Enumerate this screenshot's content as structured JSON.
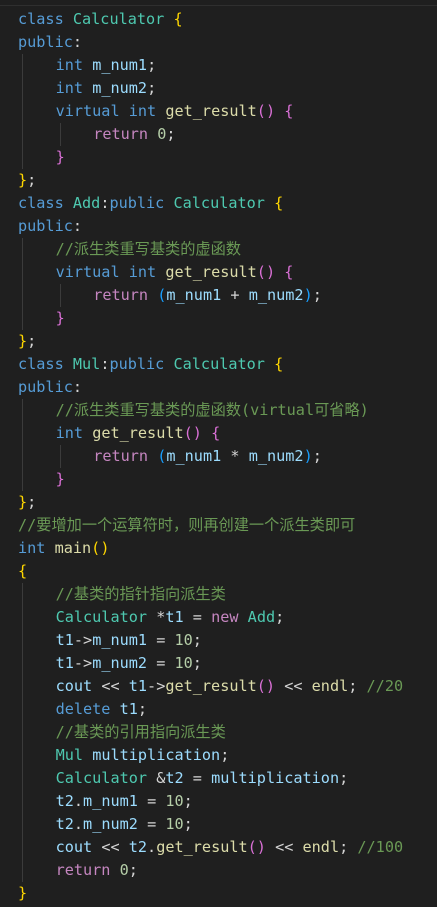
{
  "editor": {
    "language": "cpp",
    "colors": {
      "background": "#1f1f1f",
      "keyword": "#569cd6",
      "control": "#c586c0",
      "type": "#4ec9b0",
      "function": "#dcdcaa",
      "variable": "#9cdcfe",
      "number": "#b5cea8",
      "comment": "#6a9955",
      "text": "#d4d4d4",
      "bracket_1": "#ffd700",
      "bracket_2": "#da70d6",
      "bracket_3": "#179fff"
    },
    "lines": [
      {
        "indent": 0,
        "tokens": [
          {
            "k": "kw",
            "t": "class"
          },
          {
            "k": "pu",
            "t": " "
          },
          {
            "k": "ty",
            "t": "Calculator"
          },
          {
            "k": "pu",
            "t": " "
          },
          {
            "k": "b1",
            "t": "{"
          }
        ]
      },
      {
        "indent": 0,
        "tokens": [
          {
            "k": "kw",
            "t": "public"
          },
          {
            "k": "pu",
            "t": ":"
          }
        ]
      },
      {
        "indent": 1,
        "tokens": [
          {
            "k": "kw",
            "t": "int"
          },
          {
            "k": "pu",
            "t": " "
          },
          {
            "k": "var",
            "t": "m_num1"
          },
          {
            "k": "pu",
            "t": ";"
          }
        ]
      },
      {
        "indent": 1,
        "tokens": [
          {
            "k": "kw",
            "t": "int"
          },
          {
            "k": "pu",
            "t": " "
          },
          {
            "k": "var",
            "t": "m_num2"
          },
          {
            "k": "pu",
            "t": ";"
          }
        ]
      },
      {
        "indent": 1,
        "tokens": [
          {
            "k": "kw",
            "t": "virtual"
          },
          {
            "k": "pu",
            "t": " "
          },
          {
            "k": "kw",
            "t": "int"
          },
          {
            "k": "pu",
            "t": " "
          },
          {
            "k": "fn",
            "t": "get_result"
          },
          {
            "k": "b2",
            "t": "()"
          },
          {
            "k": "pu",
            "t": " "
          },
          {
            "k": "b2",
            "t": "{"
          }
        ]
      },
      {
        "indent": 2,
        "tokens": [
          {
            "k": "ctl",
            "t": "return"
          },
          {
            "k": "pu",
            "t": " "
          },
          {
            "k": "num",
            "t": "0"
          },
          {
            "k": "pu",
            "t": ";"
          }
        ]
      },
      {
        "indent": 1,
        "tokens": [
          {
            "k": "b2",
            "t": "}"
          }
        ]
      },
      {
        "indent": 0,
        "tokens": [
          {
            "k": "b1",
            "t": "}"
          },
          {
            "k": "pu",
            "t": ";"
          }
        ]
      },
      {
        "indent": 0,
        "tokens": [
          {
            "k": "kw",
            "t": "class"
          },
          {
            "k": "pu",
            "t": " "
          },
          {
            "k": "ty",
            "t": "Add"
          },
          {
            "k": "pu",
            "t": ":"
          },
          {
            "k": "kw",
            "t": "public"
          },
          {
            "k": "pu",
            "t": " "
          },
          {
            "k": "ty",
            "t": "Calculator"
          },
          {
            "k": "pu",
            "t": " "
          },
          {
            "k": "b1",
            "t": "{"
          }
        ]
      },
      {
        "indent": 0,
        "tokens": [
          {
            "k": "kw",
            "t": "public"
          },
          {
            "k": "pu",
            "t": ":"
          }
        ]
      },
      {
        "indent": 1,
        "tokens": [
          {
            "k": "cm",
            "t": "//派生类重写基类的虚函数"
          }
        ]
      },
      {
        "indent": 1,
        "tokens": [
          {
            "k": "kw",
            "t": "virtual"
          },
          {
            "k": "pu",
            "t": " "
          },
          {
            "k": "kw",
            "t": "int"
          },
          {
            "k": "pu",
            "t": " "
          },
          {
            "k": "fn",
            "t": "get_result"
          },
          {
            "k": "b2",
            "t": "()"
          },
          {
            "k": "pu",
            "t": " "
          },
          {
            "k": "b2",
            "t": "{"
          }
        ]
      },
      {
        "indent": 2,
        "tokens": [
          {
            "k": "ctl",
            "t": "return"
          },
          {
            "k": "pu",
            "t": " "
          },
          {
            "k": "b3",
            "t": "("
          },
          {
            "k": "var",
            "t": "m_num1"
          },
          {
            "k": "op",
            "t": " + "
          },
          {
            "k": "var",
            "t": "m_num2"
          },
          {
            "k": "b3",
            "t": ")"
          },
          {
            "k": "pu",
            "t": ";"
          }
        ]
      },
      {
        "indent": 1,
        "tokens": [
          {
            "k": "b2",
            "t": "}"
          }
        ]
      },
      {
        "indent": 0,
        "tokens": [
          {
            "k": "b1",
            "t": "}"
          },
          {
            "k": "pu",
            "t": ";"
          }
        ]
      },
      {
        "indent": 0,
        "tokens": [
          {
            "k": "kw",
            "t": "class"
          },
          {
            "k": "pu",
            "t": " "
          },
          {
            "k": "ty",
            "t": "Mul"
          },
          {
            "k": "pu",
            "t": ":"
          },
          {
            "k": "kw",
            "t": "public"
          },
          {
            "k": "pu",
            "t": " "
          },
          {
            "k": "ty",
            "t": "Calculator"
          },
          {
            "k": "pu",
            "t": " "
          },
          {
            "k": "b1",
            "t": "{"
          }
        ]
      },
      {
        "indent": 0,
        "tokens": [
          {
            "k": "kw",
            "t": "public"
          },
          {
            "k": "pu",
            "t": ":"
          }
        ]
      },
      {
        "indent": 1,
        "tokens": [
          {
            "k": "cm",
            "t": "//派生类重写基类的虚函数(virtual可省略)"
          }
        ]
      },
      {
        "indent": 1,
        "tokens": [
          {
            "k": "kw",
            "t": "int"
          },
          {
            "k": "pu",
            "t": " "
          },
          {
            "k": "fn",
            "t": "get_result"
          },
          {
            "k": "b2",
            "t": "()"
          },
          {
            "k": "pu",
            "t": " "
          },
          {
            "k": "b2",
            "t": "{"
          }
        ]
      },
      {
        "indent": 2,
        "tokens": [
          {
            "k": "ctl",
            "t": "return"
          },
          {
            "k": "pu",
            "t": " "
          },
          {
            "k": "b3",
            "t": "("
          },
          {
            "k": "var",
            "t": "m_num1"
          },
          {
            "k": "op",
            "t": " * "
          },
          {
            "k": "var",
            "t": "m_num2"
          },
          {
            "k": "b3",
            "t": ")"
          },
          {
            "k": "pu",
            "t": ";"
          }
        ]
      },
      {
        "indent": 1,
        "tokens": [
          {
            "k": "b2",
            "t": "}"
          }
        ]
      },
      {
        "indent": 0,
        "tokens": [
          {
            "k": "b1",
            "t": "}"
          },
          {
            "k": "pu",
            "t": ";"
          }
        ]
      },
      {
        "indent": 0,
        "tokens": [
          {
            "k": "cm",
            "t": "//要增加一个运算符时，则再创建一个派生类即可"
          }
        ]
      },
      {
        "indent": 0,
        "tokens": [
          {
            "k": "kw",
            "t": "int"
          },
          {
            "k": "pu",
            "t": " "
          },
          {
            "k": "fn",
            "t": "main"
          },
          {
            "k": "b1",
            "t": "()"
          }
        ]
      },
      {
        "indent": 0,
        "tokens": [
          {
            "k": "b1",
            "t": "{"
          }
        ]
      },
      {
        "indent": 1,
        "tokens": [
          {
            "k": "cm",
            "t": "//基类的指针指向派生类"
          }
        ]
      },
      {
        "indent": 1,
        "tokens": [
          {
            "k": "ty",
            "t": "Calculator"
          },
          {
            "k": "pu",
            "t": " "
          },
          {
            "k": "op",
            "t": "*"
          },
          {
            "k": "var",
            "t": "t1"
          },
          {
            "k": "op",
            "t": " = "
          },
          {
            "k": "ctl",
            "t": "new"
          },
          {
            "k": "pu",
            "t": " "
          },
          {
            "k": "ty",
            "t": "Add"
          },
          {
            "k": "pu",
            "t": ";"
          }
        ]
      },
      {
        "indent": 1,
        "tokens": [
          {
            "k": "var",
            "t": "t1"
          },
          {
            "k": "op",
            "t": "->"
          },
          {
            "k": "mem",
            "t": "m_num1"
          },
          {
            "k": "op",
            "t": " = "
          },
          {
            "k": "num",
            "t": "10"
          },
          {
            "k": "pu",
            "t": ";"
          }
        ]
      },
      {
        "indent": 1,
        "tokens": [
          {
            "k": "var",
            "t": "t1"
          },
          {
            "k": "op",
            "t": "->"
          },
          {
            "k": "mem",
            "t": "m_num2"
          },
          {
            "k": "op",
            "t": " = "
          },
          {
            "k": "num",
            "t": "10"
          },
          {
            "k": "pu",
            "t": ";"
          }
        ]
      },
      {
        "indent": 1,
        "tokens": [
          {
            "k": "var",
            "t": "cout"
          },
          {
            "k": "op",
            "t": " << "
          },
          {
            "k": "var",
            "t": "t1"
          },
          {
            "k": "op",
            "t": "->"
          },
          {
            "k": "fn",
            "t": "get_result"
          },
          {
            "k": "b2",
            "t": "()"
          },
          {
            "k": "op",
            "t": " << "
          },
          {
            "k": "fn",
            "t": "endl"
          },
          {
            "k": "pu",
            "t": "; "
          },
          {
            "k": "cm",
            "t": "//20"
          }
        ]
      },
      {
        "indent": 1,
        "tokens": [
          {
            "k": "kw",
            "t": "delete"
          },
          {
            "k": "pu",
            "t": " "
          },
          {
            "k": "var",
            "t": "t1"
          },
          {
            "k": "pu",
            "t": ";"
          }
        ]
      },
      {
        "indent": 1,
        "tokens": [
          {
            "k": "cm",
            "t": "//基类的引用指向派生类"
          }
        ]
      },
      {
        "indent": 1,
        "tokens": [
          {
            "k": "ty",
            "t": "Mul"
          },
          {
            "k": "pu",
            "t": " "
          },
          {
            "k": "var",
            "t": "multiplication"
          },
          {
            "k": "pu",
            "t": ";"
          }
        ]
      },
      {
        "indent": 1,
        "tokens": [
          {
            "k": "ty",
            "t": "Calculator"
          },
          {
            "k": "pu",
            "t": " "
          },
          {
            "k": "op",
            "t": "&"
          },
          {
            "k": "var",
            "t": "t2"
          },
          {
            "k": "op",
            "t": " = "
          },
          {
            "k": "var",
            "t": "multiplication"
          },
          {
            "k": "pu",
            "t": ";"
          }
        ]
      },
      {
        "indent": 1,
        "tokens": [
          {
            "k": "var",
            "t": "t2"
          },
          {
            "k": "pu",
            "t": "."
          },
          {
            "k": "mem",
            "t": "m_num1"
          },
          {
            "k": "op",
            "t": " = "
          },
          {
            "k": "num",
            "t": "10"
          },
          {
            "k": "pu",
            "t": ";"
          }
        ]
      },
      {
        "indent": 1,
        "tokens": [
          {
            "k": "var",
            "t": "t2"
          },
          {
            "k": "pu",
            "t": "."
          },
          {
            "k": "mem",
            "t": "m_num2"
          },
          {
            "k": "op",
            "t": " = "
          },
          {
            "k": "num",
            "t": "10"
          },
          {
            "k": "pu",
            "t": ";"
          }
        ]
      },
      {
        "indent": 1,
        "tokens": [
          {
            "k": "var",
            "t": "cout"
          },
          {
            "k": "op",
            "t": " << "
          },
          {
            "k": "var",
            "t": "t2"
          },
          {
            "k": "pu",
            "t": "."
          },
          {
            "k": "fn",
            "t": "get_result"
          },
          {
            "k": "b2",
            "t": "()"
          },
          {
            "k": "op",
            "t": " << "
          },
          {
            "k": "fn",
            "t": "endl"
          },
          {
            "k": "pu",
            "t": "; "
          },
          {
            "k": "cm",
            "t": "//100"
          }
        ]
      },
      {
        "indent": 1,
        "tokens": [
          {
            "k": "ctl",
            "t": "return"
          },
          {
            "k": "pu",
            "t": " "
          },
          {
            "k": "num",
            "t": "0"
          },
          {
            "k": "pu",
            "t": ";"
          }
        ]
      },
      {
        "indent": 0,
        "tokens": [
          {
            "k": "b1",
            "t": "}"
          }
        ]
      }
    ]
  }
}
